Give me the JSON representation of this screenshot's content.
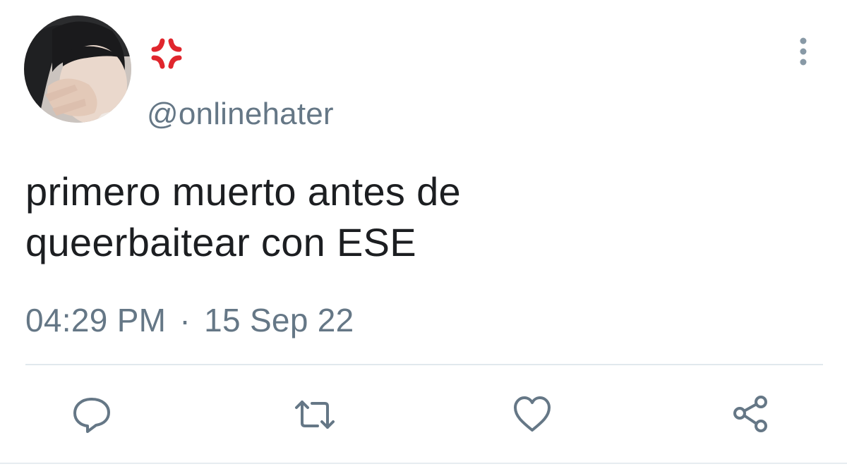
{
  "tweet": {
    "display_name_icon": "anger-symbol-icon",
    "handle": "@onlinehater",
    "text": "primero muerto antes de\nqueerbaitear con ESE",
    "time": "04:29 PM",
    "separator": "·",
    "date": "15 Sep 22"
  },
  "actions": [
    {
      "icon": "reply-icon"
    },
    {
      "icon": "retweet-icon"
    },
    {
      "icon": "like-icon"
    },
    {
      "icon": "share-icon"
    }
  ],
  "colors": {
    "muted": "#657786",
    "text": "#1c1e21",
    "anger_red": "#e0262d",
    "divider": "#e1e8ed"
  }
}
